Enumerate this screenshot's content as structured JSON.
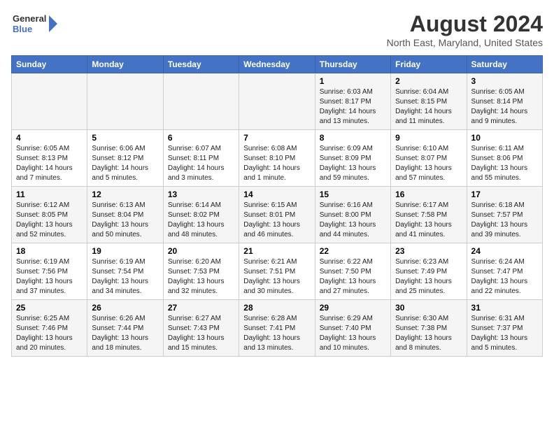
{
  "header": {
    "logo_line1": "General",
    "logo_line2": "Blue",
    "title": "August 2024",
    "subtitle": "North East, Maryland, United States"
  },
  "weekdays": [
    "Sunday",
    "Monday",
    "Tuesday",
    "Wednesday",
    "Thursday",
    "Friday",
    "Saturday"
  ],
  "weeks": [
    [
      {
        "day": "",
        "info": ""
      },
      {
        "day": "",
        "info": ""
      },
      {
        "day": "",
        "info": ""
      },
      {
        "day": "",
        "info": ""
      },
      {
        "day": "1",
        "info": "Sunrise: 6:03 AM\nSunset: 8:17 PM\nDaylight: 14 hours\nand 13 minutes."
      },
      {
        "day": "2",
        "info": "Sunrise: 6:04 AM\nSunset: 8:15 PM\nDaylight: 14 hours\nand 11 minutes."
      },
      {
        "day": "3",
        "info": "Sunrise: 6:05 AM\nSunset: 8:14 PM\nDaylight: 14 hours\nand 9 minutes."
      }
    ],
    [
      {
        "day": "4",
        "info": "Sunrise: 6:05 AM\nSunset: 8:13 PM\nDaylight: 14 hours\nand 7 minutes."
      },
      {
        "day": "5",
        "info": "Sunrise: 6:06 AM\nSunset: 8:12 PM\nDaylight: 14 hours\nand 5 minutes."
      },
      {
        "day": "6",
        "info": "Sunrise: 6:07 AM\nSunset: 8:11 PM\nDaylight: 14 hours\nand 3 minutes."
      },
      {
        "day": "7",
        "info": "Sunrise: 6:08 AM\nSunset: 8:10 PM\nDaylight: 14 hours\nand 1 minute."
      },
      {
        "day": "8",
        "info": "Sunrise: 6:09 AM\nSunset: 8:09 PM\nDaylight: 13 hours\nand 59 minutes."
      },
      {
        "day": "9",
        "info": "Sunrise: 6:10 AM\nSunset: 8:07 PM\nDaylight: 13 hours\nand 57 minutes."
      },
      {
        "day": "10",
        "info": "Sunrise: 6:11 AM\nSunset: 8:06 PM\nDaylight: 13 hours\nand 55 minutes."
      }
    ],
    [
      {
        "day": "11",
        "info": "Sunrise: 6:12 AM\nSunset: 8:05 PM\nDaylight: 13 hours\nand 52 minutes."
      },
      {
        "day": "12",
        "info": "Sunrise: 6:13 AM\nSunset: 8:04 PM\nDaylight: 13 hours\nand 50 minutes."
      },
      {
        "day": "13",
        "info": "Sunrise: 6:14 AM\nSunset: 8:02 PM\nDaylight: 13 hours\nand 48 minutes."
      },
      {
        "day": "14",
        "info": "Sunrise: 6:15 AM\nSunset: 8:01 PM\nDaylight: 13 hours\nand 46 minutes."
      },
      {
        "day": "15",
        "info": "Sunrise: 6:16 AM\nSunset: 8:00 PM\nDaylight: 13 hours\nand 44 minutes."
      },
      {
        "day": "16",
        "info": "Sunrise: 6:17 AM\nSunset: 7:58 PM\nDaylight: 13 hours\nand 41 minutes."
      },
      {
        "day": "17",
        "info": "Sunrise: 6:18 AM\nSunset: 7:57 PM\nDaylight: 13 hours\nand 39 minutes."
      }
    ],
    [
      {
        "day": "18",
        "info": "Sunrise: 6:19 AM\nSunset: 7:56 PM\nDaylight: 13 hours\nand 37 minutes."
      },
      {
        "day": "19",
        "info": "Sunrise: 6:19 AM\nSunset: 7:54 PM\nDaylight: 13 hours\nand 34 minutes."
      },
      {
        "day": "20",
        "info": "Sunrise: 6:20 AM\nSunset: 7:53 PM\nDaylight: 13 hours\nand 32 minutes."
      },
      {
        "day": "21",
        "info": "Sunrise: 6:21 AM\nSunset: 7:51 PM\nDaylight: 13 hours\nand 30 minutes."
      },
      {
        "day": "22",
        "info": "Sunrise: 6:22 AM\nSunset: 7:50 PM\nDaylight: 13 hours\nand 27 minutes."
      },
      {
        "day": "23",
        "info": "Sunrise: 6:23 AM\nSunset: 7:49 PM\nDaylight: 13 hours\nand 25 minutes."
      },
      {
        "day": "24",
        "info": "Sunrise: 6:24 AM\nSunset: 7:47 PM\nDaylight: 13 hours\nand 22 minutes."
      }
    ],
    [
      {
        "day": "25",
        "info": "Sunrise: 6:25 AM\nSunset: 7:46 PM\nDaylight: 13 hours\nand 20 minutes."
      },
      {
        "day": "26",
        "info": "Sunrise: 6:26 AM\nSunset: 7:44 PM\nDaylight: 13 hours\nand 18 minutes."
      },
      {
        "day": "27",
        "info": "Sunrise: 6:27 AM\nSunset: 7:43 PM\nDaylight: 13 hours\nand 15 minutes."
      },
      {
        "day": "28",
        "info": "Sunrise: 6:28 AM\nSunset: 7:41 PM\nDaylight: 13 hours\nand 13 minutes."
      },
      {
        "day": "29",
        "info": "Sunrise: 6:29 AM\nSunset: 7:40 PM\nDaylight: 13 hours\nand 10 minutes."
      },
      {
        "day": "30",
        "info": "Sunrise: 6:30 AM\nSunset: 7:38 PM\nDaylight: 13 hours\nand 8 minutes."
      },
      {
        "day": "31",
        "info": "Sunrise: 6:31 AM\nSunset: 7:37 PM\nDaylight: 13 hours\nand 5 minutes."
      }
    ]
  ]
}
